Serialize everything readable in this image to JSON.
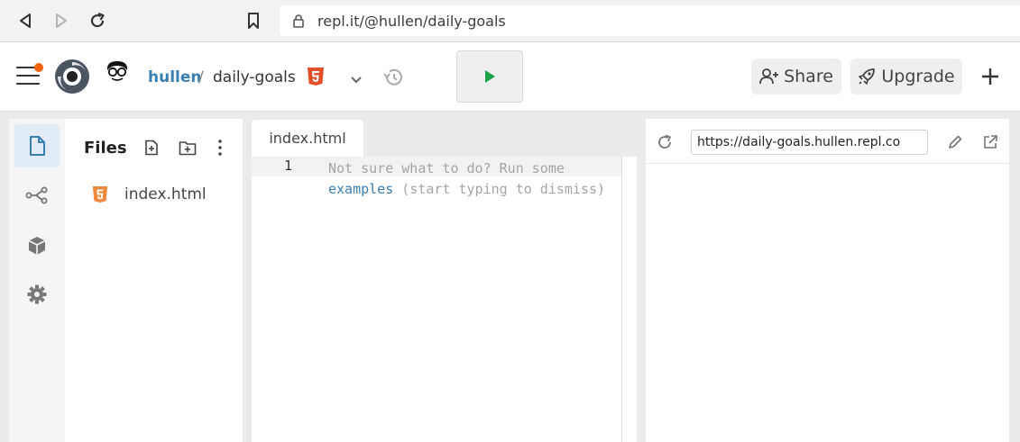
{
  "browser": {
    "url": "repl.it/@hullen/daily-goals",
    "back_icon": "back-arrow-icon",
    "forward_icon": "forward-arrow-icon",
    "reload_icon": "reload-icon",
    "bookmark_icon": "bookmark-icon",
    "lock_icon": "lock-icon"
  },
  "header": {
    "username": "hullen",
    "separator": "/",
    "repl_name": "daily-goals",
    "share_label": "Share",
    "upgrade_label": "Upgrade",
    "accent_color": "#3a7fb3",
    "run_color": "#1aa34a",
    "notification_color": "#f26207"
  },
  "files": {
    "title": "Files",
    "items": [
      {
        "name": "index.html",
        "icon": "html5-icon"
      }
    ]
  },
  "editor": {
    "tab_label": "index.html",
    "line_number": "1",
    "placeholder_before": "Not sure what to do? Run some",
    "placeholder_link": "examples",
    "placeholder_after": " (start typing to dismiss)"
  },
  "webview": {
    "url": "https://daily-goals.hullen.repl.co"
  }
}
